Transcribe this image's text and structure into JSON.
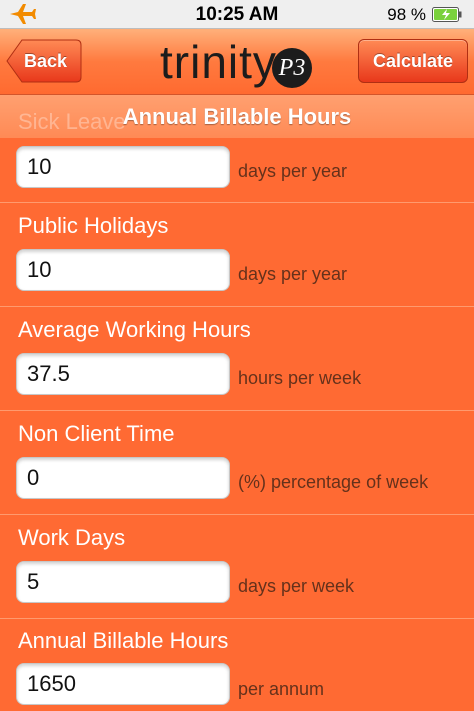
{
  "status_bar": {
    "time": "10:25 AM",
    "battery_percent": "98 %",
    "icons": [
      "airplane-mode-icon",
      "battery-icon"
    ]
  },
  "nav": {
    "back_label": "Back",
    "calculate_label": "Calculate",
    "logo_text": "trinity",
    "logo_badge": "P3"
  },
  "section": {
    "title": "Annual Billable Hours",
    "scrolled_label": "Sick Leave"
  },
  "rows": [
    {
      "value": "10",
      "unit": "days per year"
    },
    {
      "label": "Public Holidays",
      "value": "10",
      "unit": "days per year"
    },
    {
      "label": "Average Working Hours",
      "value": "37.5",
      "unit": "hours per week"
    },
    {
      "label": "Non Client Time",
      "value": "0",
      "unit": "(%) percentage of week"
    },
    {
      "label": "Work Days",
      "value": "5",
      "unit": "days per week"
    },
    {
      "label": "Annual Billable Hours",
      "value": "1650",
      "unit": "per annum"
    }
  ],
  "colors": {
    "background": "#ff6a33",
    "nav_gradient_top": "#ffb07a",
    "button_red": "#e8381b"
  }
}
